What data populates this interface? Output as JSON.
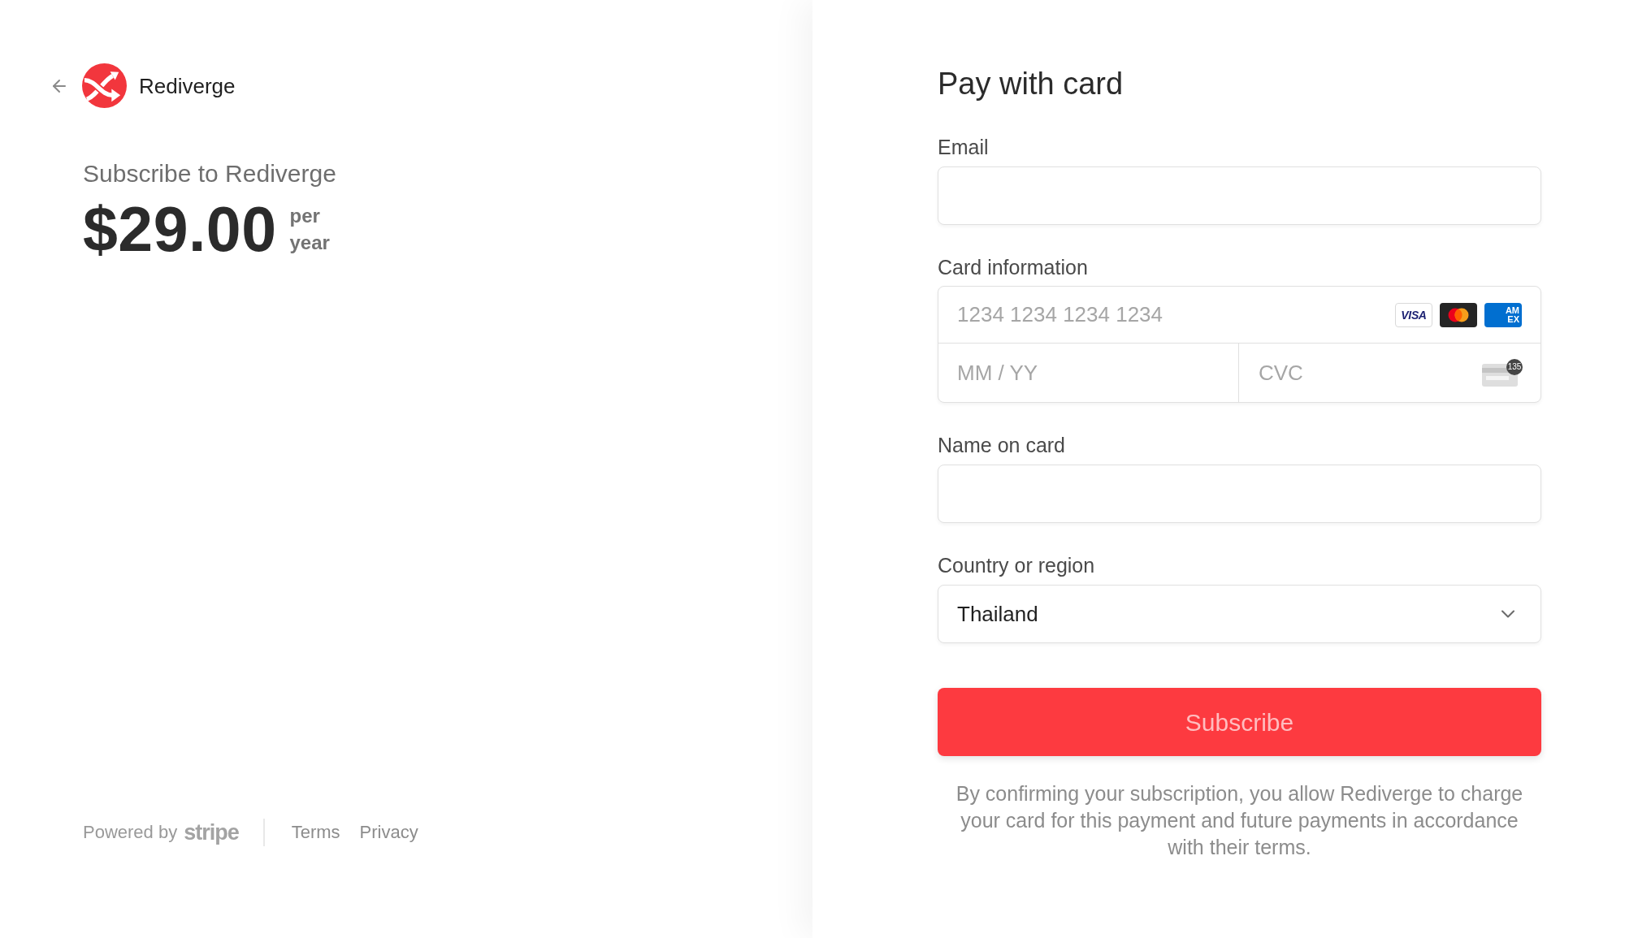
{
  "merchant": {
    "name": "Rediverge"
  },
  "summary": {
    "title": "Subscribe to Rediverge",
    "price": "$29.00",
    "period": "per year"
  },
  "footer": {
    "powered_by": "Powered by",
    "brand": "stripe",
    "links": [
      "Terms",
      "Privacy"
    ]
  },
  "form": {
    "title": "Pay with card",
    "email": {
      "label": "Email"
    },
    "card": {
      "label": "Card information",
      "number_placeholder": "1234 1234 1234 1234",
      "brands": [
        {
          "kind": "visa",
          "text": "VISA"
        },
        {
          "kind": "mastercard"
        },
        {
          "kind": "amex",
          "text": "AM EX"
        }
      ],
      "expiry_placeholder": "MM / YY",
      "cvc_placeholder": "CVC",
      "cvc_badge": "135"
    },
    "name": {
      "label": "Name on card"
    },
    "country": {
      "label": "Country or region",
      "value": "Thailand"
    },
    "submit": "Subscribe",
    "terms": "By confirming your subscription, you allow Rediverge to charge your card for this payment and future payments in accordance with their terms."
  }
}
